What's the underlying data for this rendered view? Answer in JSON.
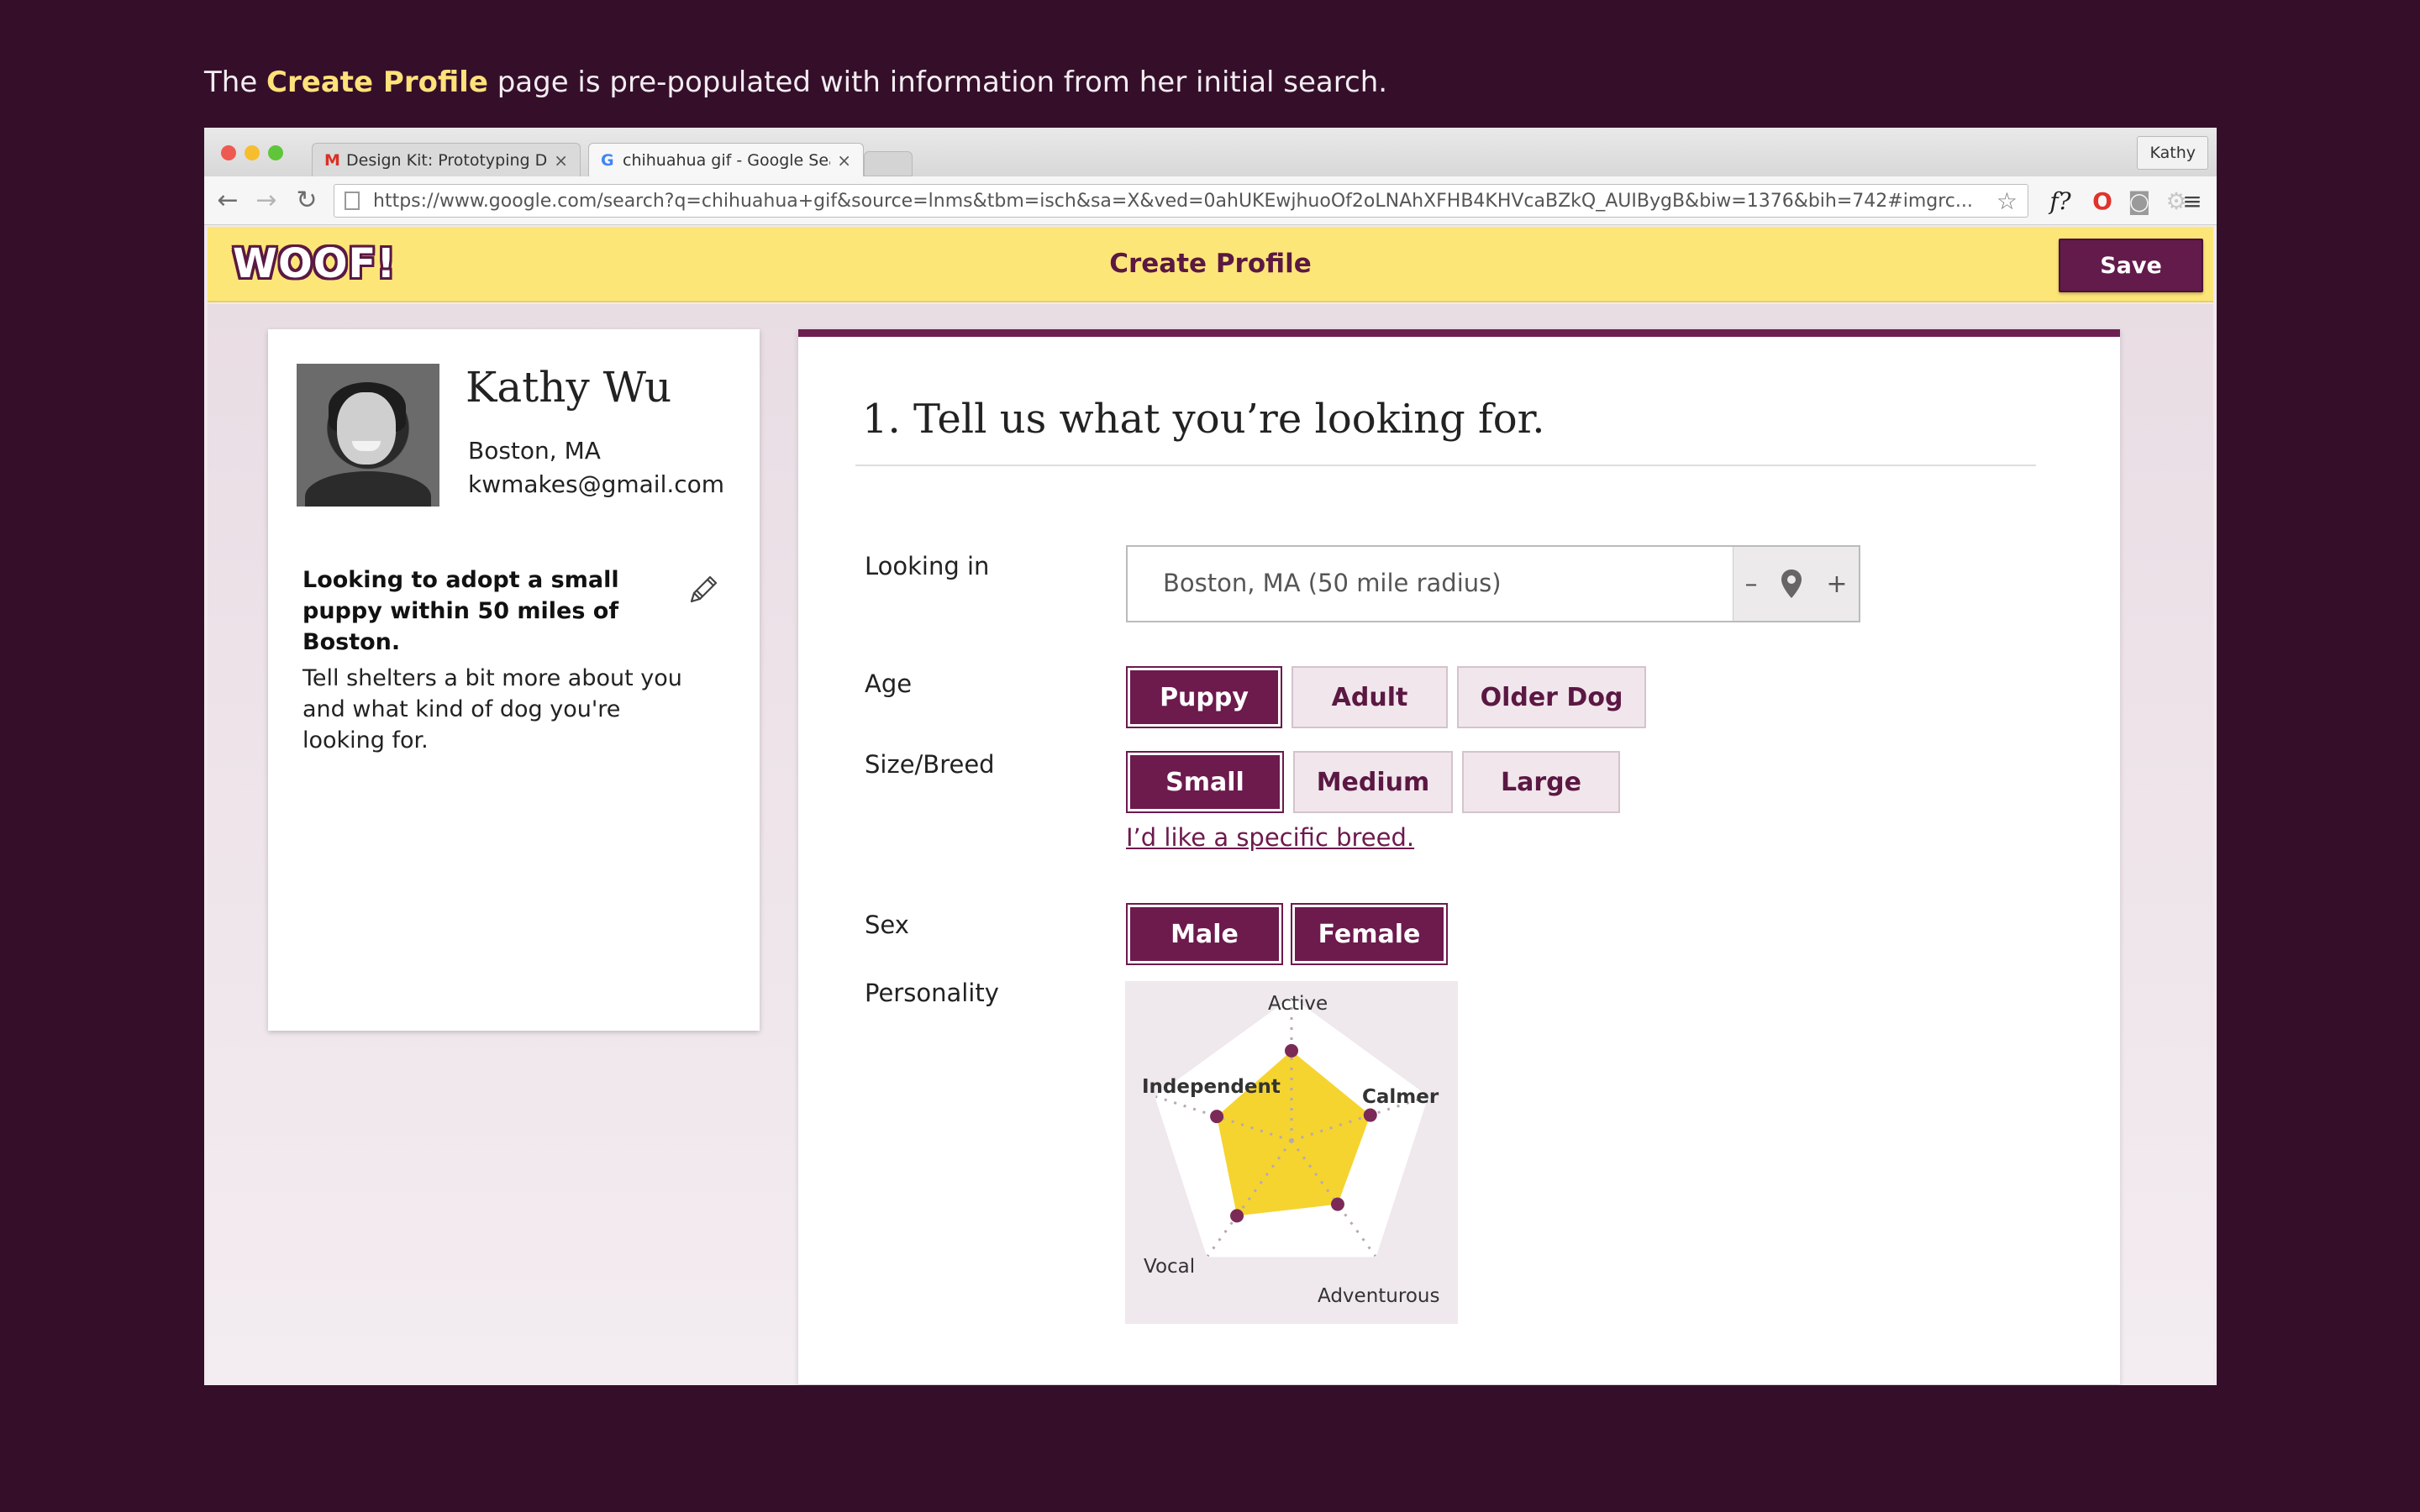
{
  "caption": {
    "before": "The ",
    "highlight": "Create Profile",
    "after": " page is pre-populated with information from her initial search."
  },
  "browser": {
    "tabs": [
      {
        "label": "Design Kit: Prototyping Da",
        "favicon": "gmail-icon"
      },
      {
        "label": "chihuahua gif - Google Sea",
        "favicon": "google-icon"
      }
    ],
    "profile_name": "Kathy",
    "url": "https://www.google.com/search?q=chihuahua+gif&source=lnms&tbm=isch&sa=X&ved=0ahUKEwjhuoOf2oLNAhXFHB4KHVcaBZkQ_AUIBygB&biw=1376&bih=742#imgrc...",
    "ext_font": "f?"
  },
  "app": {
    "logo": "WOOF!",
    "title": "Create Profile",
    "save_label": "Save",
    "brand_color": "#621b4a",
    "bar_color": "#fde678"
  },
  "profile": {
    "name": "Kathy Wu",
    "location": "Boston, MA",
    "email": "kwmakes@gmail.com",
    "summary": "Looking to adopt a small puppy within 50 miles of Boston.",
    "description": "Tell shelters a bit more about you and what kind of dog you're looking for."
  },
  "form": {
    "heading": "1. Tell us what you’re looking for.",
    "looking_in": {
      "label": "Looking in",
      "value": "Boston, MA (50 mile radius)",
      "minus": "–",
      "plus": "+"
    },
    "age": {
      "label": "Age",
      "options": [
        "Puppy",
        "Adult",
        "Older Dog"
      ],
      "selected": "Puppy"
    },
    "size": {
      "label": "Size/Breed",
      "options": [
        "Small",
        "Medium",
        "Large"
      ],
      "selected": "Small",
      "link": "I’d like a specific breed."
    },
    "sex": {
      "label": "Sex",
      "options": [
        "Male",
        "Female"
      ],
      "selected": [
        "Male",
        "Female"
      ]
    },
    "personality": {
      "label": "Personality",
      "axes": [
        "Active",
        "Calmer",
        "Adventurous",
        "Vocal",
        "Independent"
      ],
      "values": [
        0.63,
        0.58,
        0.55,
        0.65,
        0.55
      ]
    }
  }
}
